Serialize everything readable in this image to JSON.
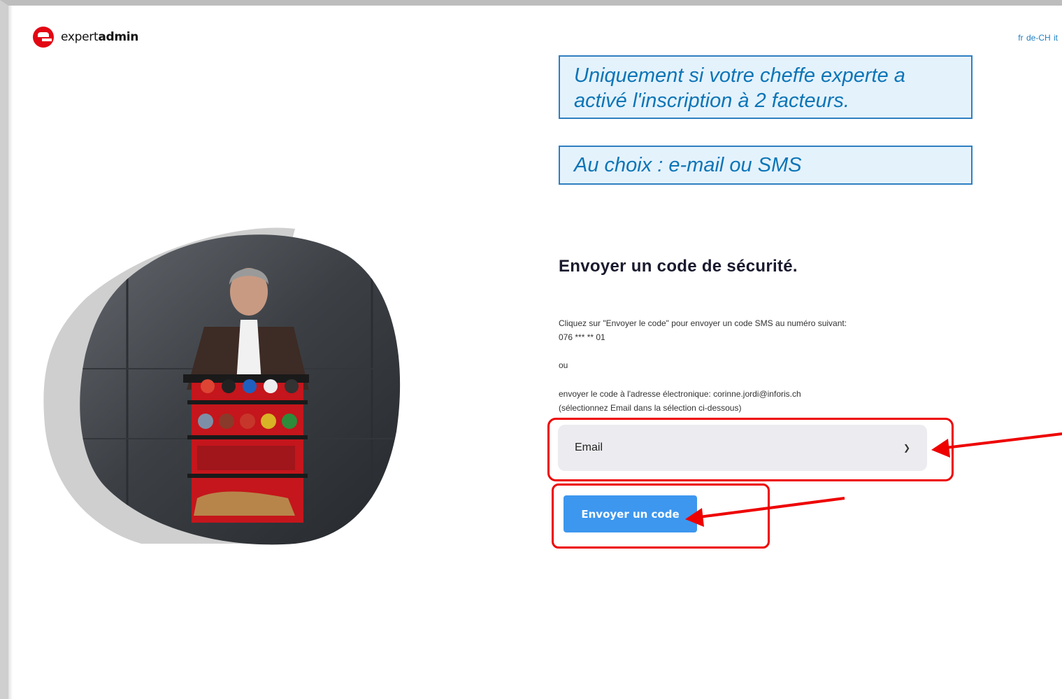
{
  "brand": {
    "logo_text_light": "expert",
    "logo_text_bold": "admin",
    "accent_color": "#e30613"
  },
  "languages": [
    "fr",
    "de-CH",
    "it"
  ],
  "annotations": {
    "note1": "Uniquement si votre cheffe experte a activé l'inscription à 2 facteurs.",
    "note2": "Au choix : e-mail ou SMS"
  },
  "main": {
    "title": "Envoyer un code de sécurité.",
    "instruction_sms": "Cliquez sur \"Envoyer le code\" pour envoyer un code SMS au numéro suivant: 076 *** ** 01",
    "or_text": "ou",
    "instruction_email": "envoyer le code à l'adresse électronique: corinne.jordi@inforis.ch (sélectionnez Email dans la sélection ci-dessous)",
    "method_select": {
      "selected": "Email"
    },
    "send_button_label": "Envoyer un code",
    "button_color": "#3d97ef"
  },
  "highlight_color": "#ee0000"
}
